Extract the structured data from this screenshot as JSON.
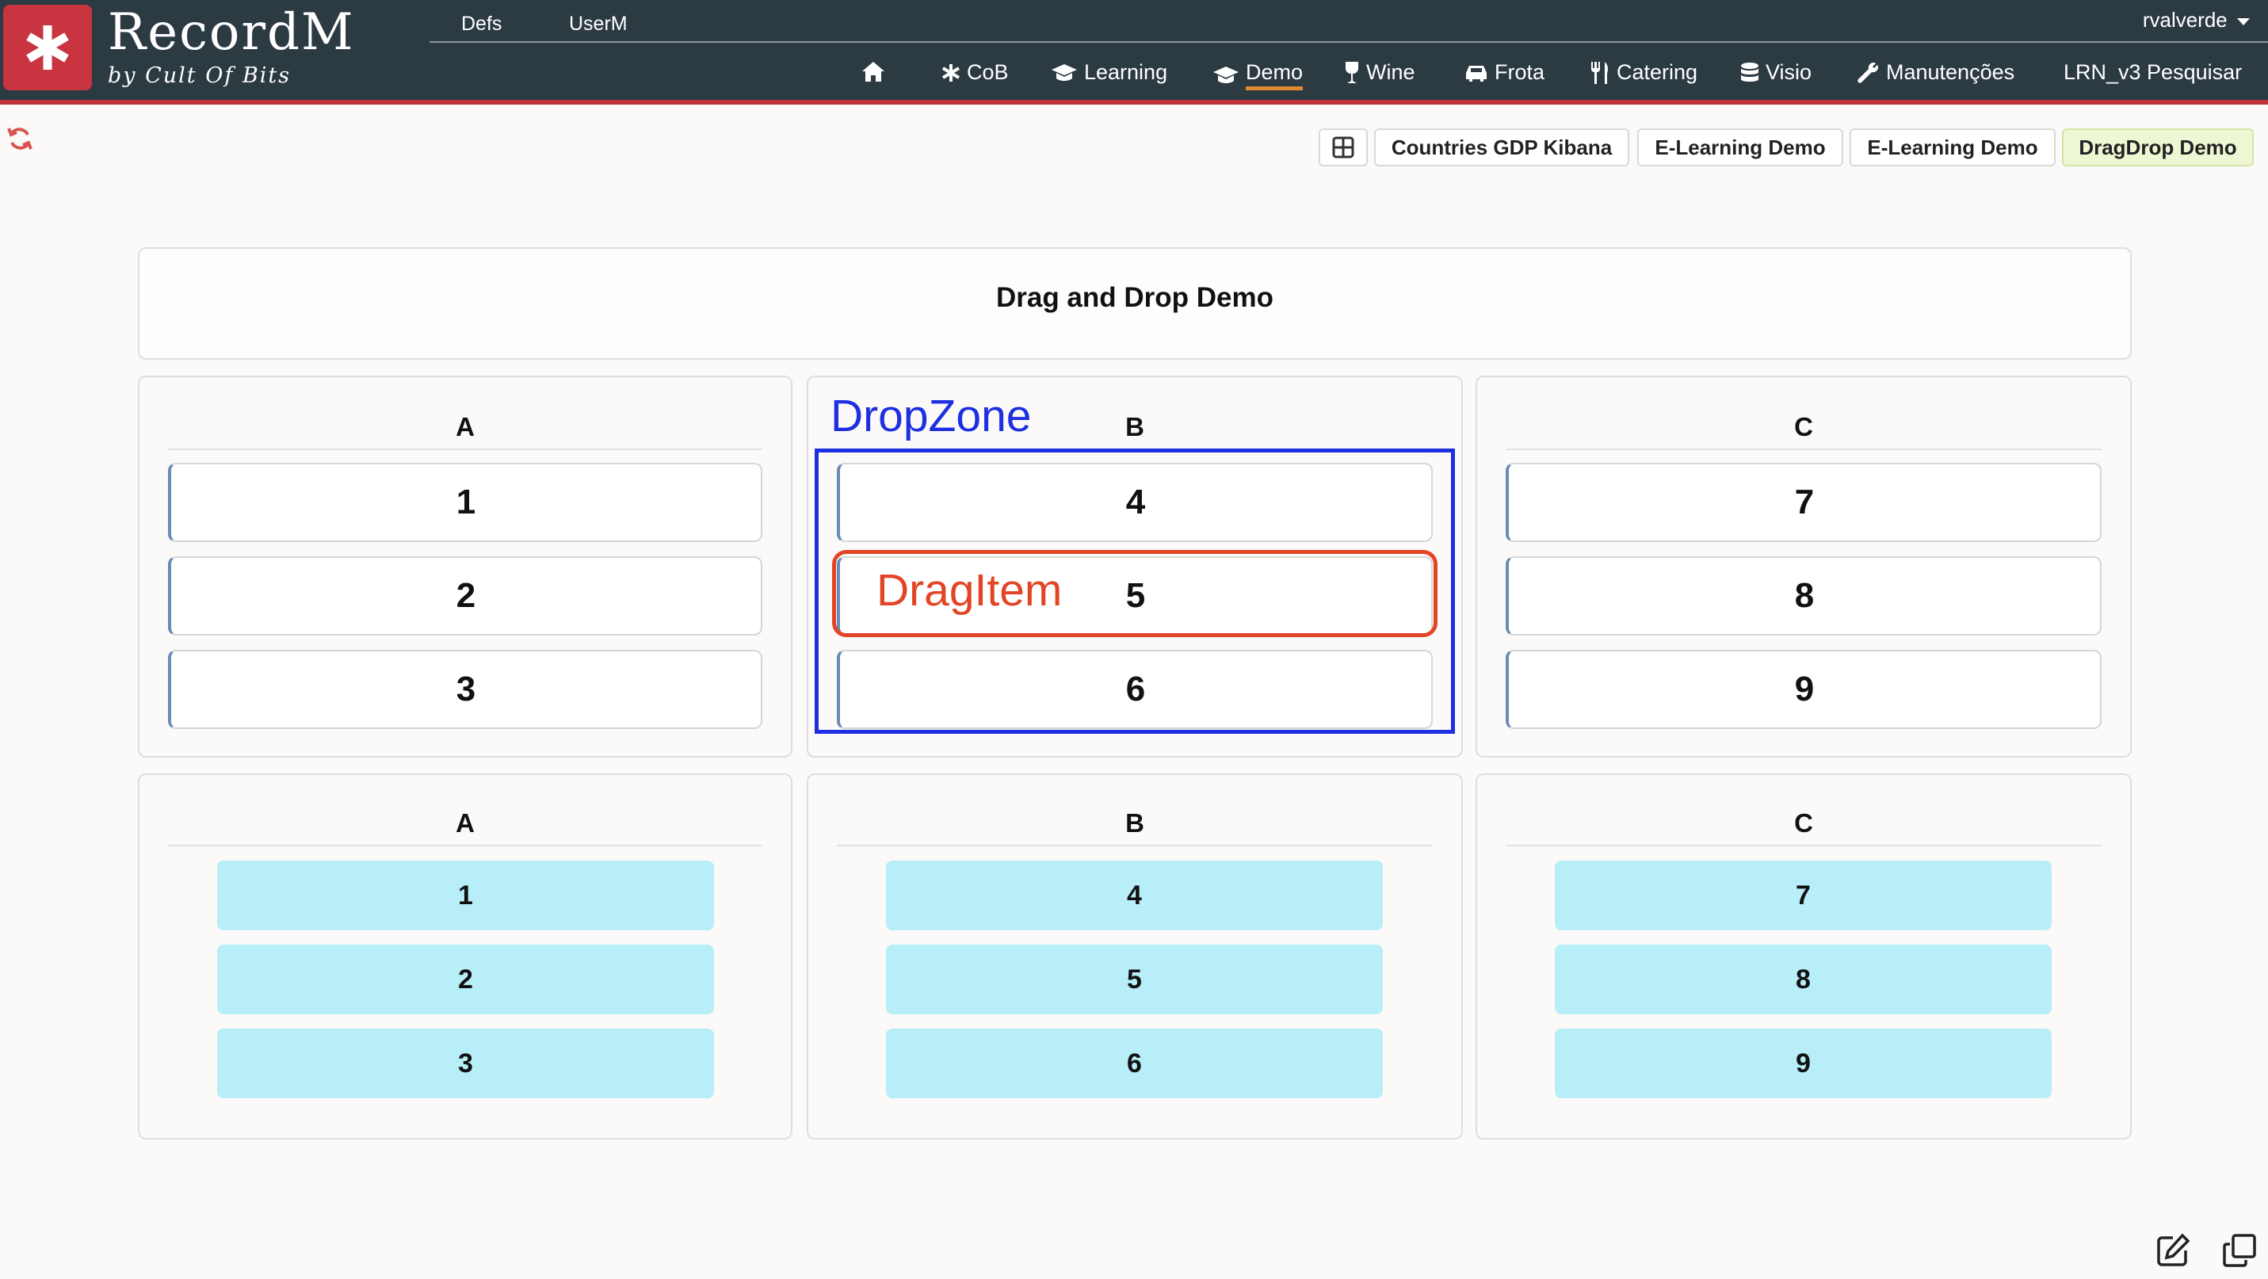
{
  "app": {
    "brand_title": "RecordM",
    "brand_subtitle": "by Cult Of Bits",
    "logo_icon": "asterisk-icon"
  },
  "top_nav": {
    "items": [
      {
        "label": "Defs"
      },
      {
        "label": "UserM"
      }
    ],
    "user": "rvalverde"
  },
  "main_nav": {
    "items": [
      {
        "label": "",
        "icon": "home-icon"
      },
      {
        "label": "CoB",
        "icon": "asterisk-icon"
      },
      {
        "label": "Learning",
        "icon": "graduation-cap-icon"
      },
      {
        "label": "Demo",
        "icon": "graduation-cap-icon",
        "active": true
      },
      {
        "label": "Wine",
        "icon": "wine-glass-icon"
      },
      {
        "label": "Frota",
        "icon": "car-icon"
      },
      {
        "label": "Catering",
        "icon": "utensils-icon"
      },
      {
        "label": "Visio",
        "icon": "database-icon"
      },
      {
        "label": "Manutenções",
        "icon": "wrench-icon"
      },
      {
        "label": "LRN_v3 Pesquisar",
        "icon": ""
      }
    ],
    "active_color": "#e08a34"
  },
  "dashboard_tabs": {
    "grid_icon": "grid-icon",
    "items": [
      {
        "label": "Countries GDP Kibana"
      },
      {
        "label": "E-Learning Demo"
      },
      {
        "label": "E-Learning Demo"
      },
      {
        "label": "DragDrop Demo",
        "active": true
      }
    ]
  },
  "page": {
    "title": "Drag and Drop Demo"
  },
  "drag_section": {
    "columns": [
      {
        "header": "A",
        "items": [
          "1",
          "2",
          "3"
        ]
      },
      {
        "header": "B",
        "items": [
          "4",
          "5",
          "6"
        ]
      },
      {
        "header": "C",
        "items": [
          "7",
          "8",
          "9"
        ]
      }
    ]
  },
  "list_section": {
    "columns": [
      {
        "header": "A",
        "items": [
          "1",
          "2",
          "3"
        ]
      },
      {
        "header": "B",
        "items": [
          "4",
          "5",
          "6"
        ]
      },
      {
        "header": "C",
        "items": [
          "7",
          "8",
          "9"
        ]
      }
    ]
  },
  "annotations": {
    "dropzone_label": "DropZone",
    "dragitem_label": "DragItem",
    "dropzone_color": "#1d2fe0",
    "dragitem_color": "#e24525"
  },
  "colors": {
    "header_bg": "#2c3a42",
    "brand_red": "#c8343f",
    "chip_bg": "#b8eef8",
    "active_tab_bg": "#eef7d3"
  }
}
